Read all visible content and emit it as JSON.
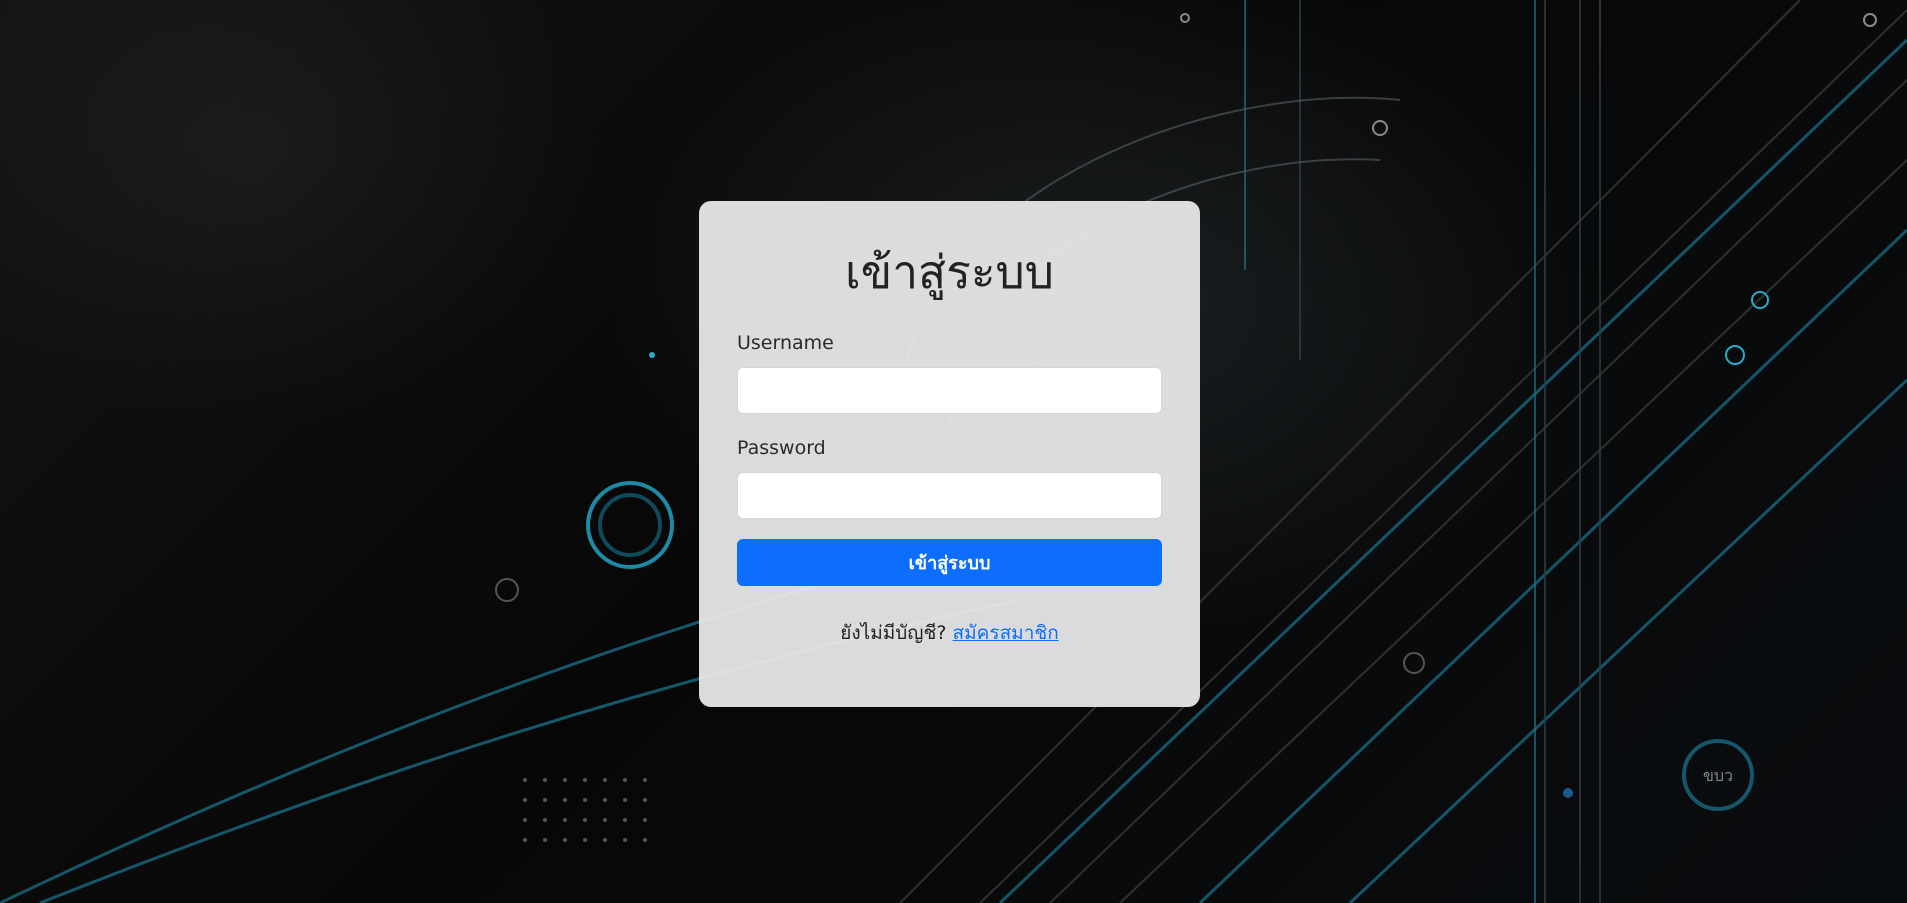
{
  "login": {
    "title": "เข้าสู่ระบบ",
    "username_label": "Username",
    "username_value": "",
    "password_label": "Password",
    "password_value": "",
    "submit_label": "เข้าสู่ระบบ",
    "no_account_text": "ยังไม่มีบัญชี?",
    "register_link": "สมัครสมาชิก"
  },
  "background": {
    "badge_text": "ขบว"
  },
  "colors": {
    "primary": "#0d6efd",
    "card_bg": "#ececec",
    "background": "#060606",
    "accent_cyan": "#2aa9c9"
  }
}
